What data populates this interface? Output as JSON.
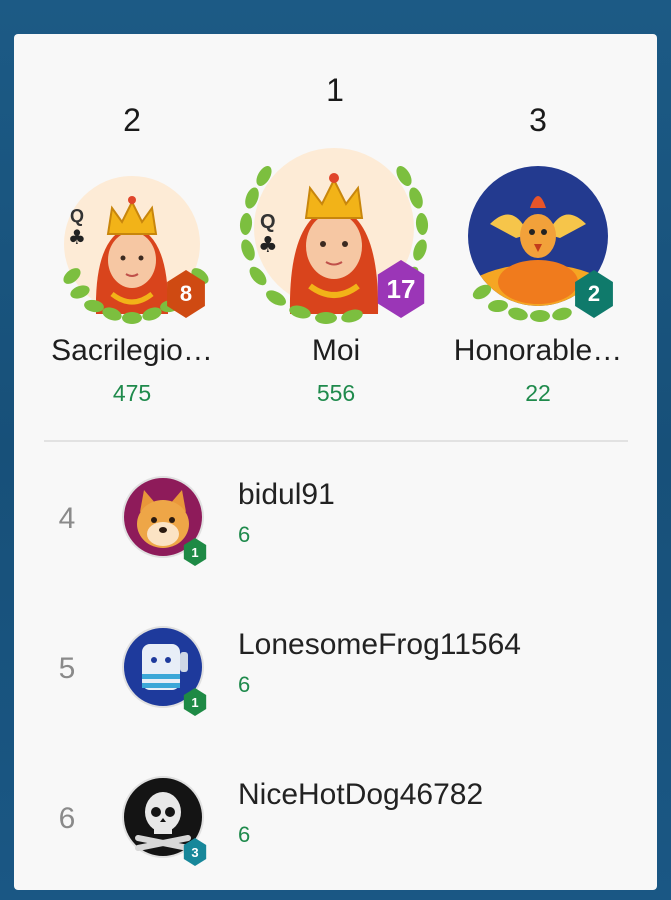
{
  "podium": [
    {
      "rank": "2",
      "name": "Sacrilegio…",
      "score": "475",
      "level": "8",
      "badge_color": "#cf4a12",
      "avatar": "queen-of-clubs-avatar"
    },
    {
      "rank": "1",
      "name": "Moi",
      "score": "556",
      "level": "17",
      "badge_color": "#9b36b7",
      "avatar": "queen-of-clubs-avatar"
    },
    {
      "rank": "3",
      "name": "Honorable…",
      "score": "22",
      "level": "2",
      "badge_color": "#0f7a6b",
      "avatar": "phoenix-avatar"
    }
  ],
  "list": [
    {
      "rank": "4",
      "name": "bidul91",
      "score": "6",
      "level": "1",
      "badge_color": "#1e8a45",
      "avatar": "shiba-dog-avatar"
    },
    {
      "rank": "5",
      "name": "LonesomeFrog11564",
      "score": "6",
      "level": "1",
      "badge_color": "#1e8a45",
      "avatar": "robot-avatar"
    },
    {
      "rank": "6",
      "name": "NiceHotDog46782",
      "score": "6",
      "level": "3",
      "badge_color": "#17879a",
      "avatar": "skull-avatar"
    }
  ],
  "colors": {
    "score_green": "#1f8a4c",
    "laurel_green": "#7cbf3f",
    "card_bg": "#f8f8f8"
  }
}
